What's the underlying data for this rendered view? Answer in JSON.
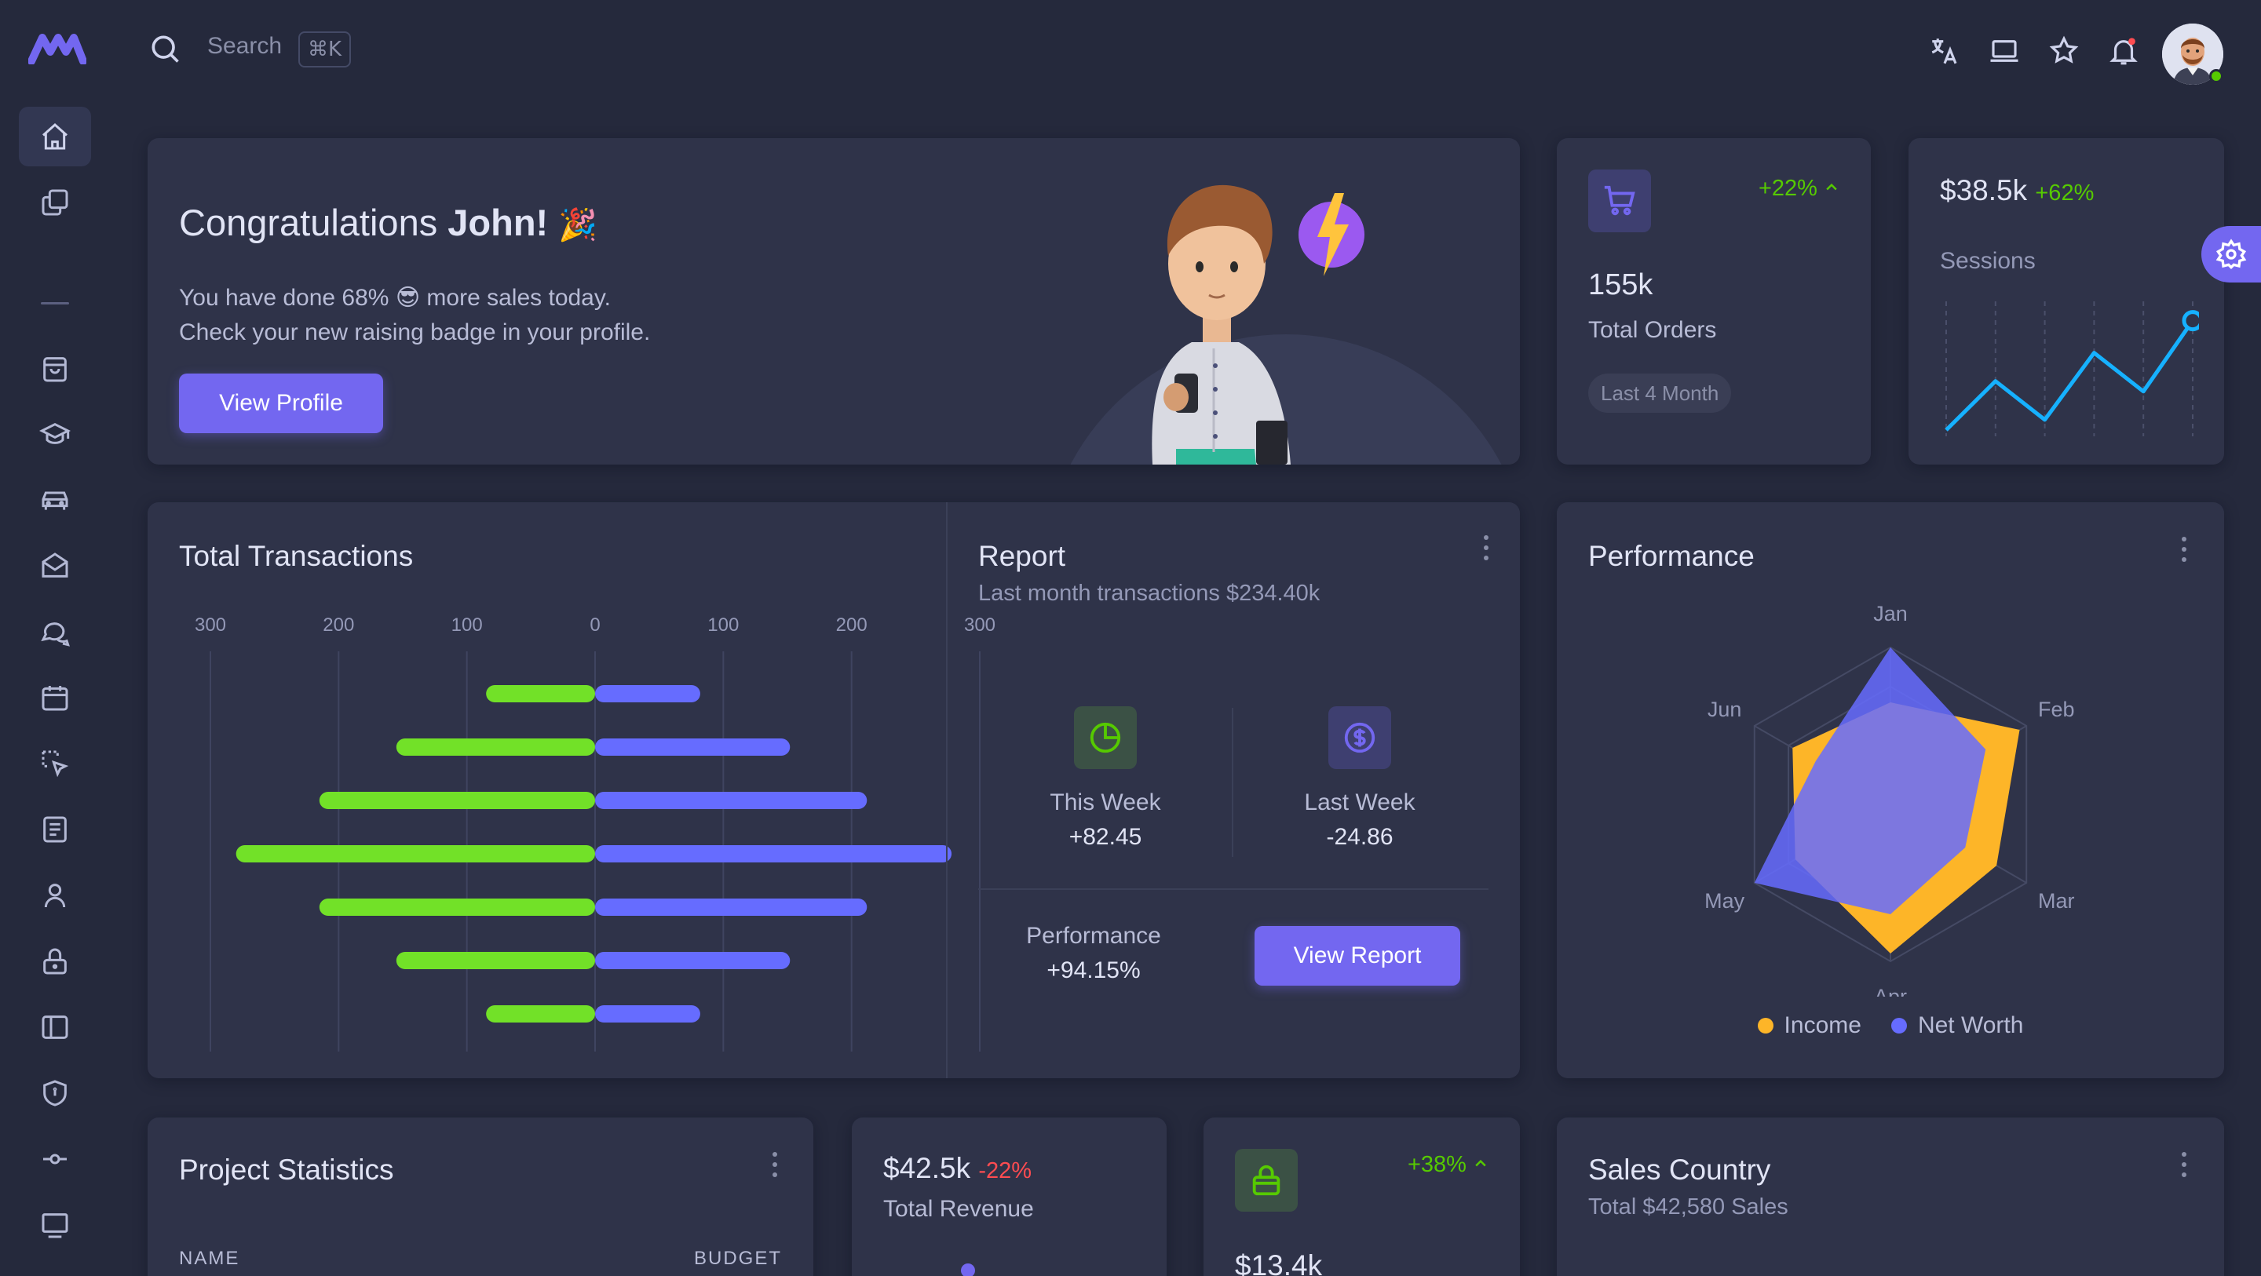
{
  "search": {
    "placeholder": "Search",
    "shortcut": "⌘K"
  },
  "congrats": {
    "title_prefix": "Congratulations ",
    "title_name": "John!",
    "emoji": "🎉",
    "line1_a": "You have done 68% ",
    "line1_emoji": "😎",
    "line1_b": " more sales today.",
    "line2": "Check your new raising badge in your profile.",
    "button": "View Profile"
  },
  "orders": {
    "change": "+22%",
    "value": "155k",
    "label": "Total Orders",
    "badge": "Last 4 Month"
  },
  "sessions": {
    "value": "$38.5k",
    "change": "+62%",
    "label": "Sessions"
  },
  "transactions": {
    "title": "Total Transactions"
  },
  "report": {
    "title": "Report",
    "subtitle": "Last month transactions $234.40k",
    "this_week_label": "This Week",
    "this_week_value": "+82.45",
    "last_week_label": "Last Week",
    "last_week_value": "-24.86",
    "performance_label": "Performance",
    "performance_value": "+94.15%",
    "button": "View Report"
  },
  "performance": {
    "title": "Performance"
  },
  "project": {
    "title": "Project Statistics",
    "col_name": "NAME",
    "col_budget": "BUDGET"
  },
  "revenue": {
    "value": "$42.5k",
    "change": "-22%",
    "label": "Total Revenue"
  },
  "sales_card": {
    "change": "+38%",
    "value": "$13.4k"
  },
  "sales_country": {
    "title": "Sales Country",
    "subtitle": "Total $42,580 Sales"
  },
  "colors": {
    "primary": "#7367f0",
    "green": "#56ca00",
    "red": "#ff4c51",
    "orange": "#fdb528",
    "cyan": "#16b1ff",
    "bar_blue": "#666cff",
    "bar_green": "#72e128"
  },
  "chart_data": [
    {
      "type": "bar",
      "orientation": "horizontal-diverging",
      "title": "Total Transactions",
      "x_ticks": [
        "300",
        "200",
        "100",
        "0",
        "100",
        "200",
        "300"
      ],
      "xlim": [
        -300,
        300
      ],
      "series": [
        {
          "values": [
            -85,
            -155,
            -215,
            -280,
            -215,
            -155,
            -85
          ]
        },
        {
          "values": [
            82,
            152,
            212,
            278,
            212,
            152,
            82
          ]
        }
      ],
      "grid": true
    },
    {
      "type": "radar",
      "title": "Performance",
      "categories": [
        "Jan",
        "Feb",
        "Mar",
        "Apr",
        "May",
        "Jun"
      ],
      "rmax": 100,
      "series": [
        {
          "name": "Income",
          "values": [
            65,
            95,
            78,
            95,
            70,
            72
          ]
        },
        {
          "name": "Net Worth",
          "values": [
            100,
            70,
            55,
            70,
            100,
            55
          ]
        }
      ],
      "legend": "bottom"
    },
    {
      "type": "line",
      "title": "",
      "label": "Sessions",
      "values": [
        0,
        38,
        8,
        60,
        30,
        85
      ],
      "ylim": [
        0,
        100
      ],
      "grid": true
    }
  ]
}
